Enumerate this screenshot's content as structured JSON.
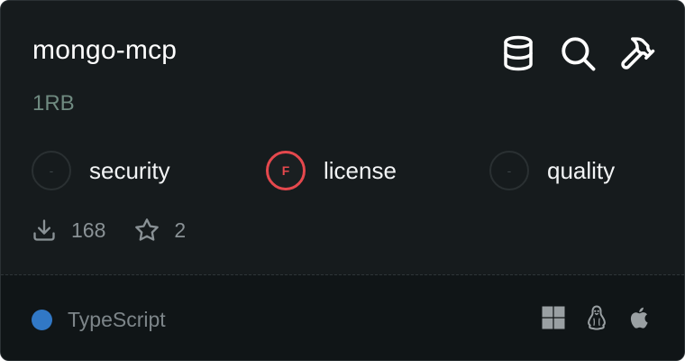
{
  "card": {
    "title": "mongo-mcp",
    "owner": "1RB",
    "header_icons": [
      "database-icon",
      "search-icon",
      "hammer-icon"
    ],
    "scores": [
      {
        "grade": "-",
        "label": "security",
        "status": "neutral"
      },
      {
        "grade": "F",
        "label": "license",
        "status": "fail"
      },
      {
        "grade": "-",
        "label": "quality",
        "status": "neutral"
      }
    ],
    "stats": {
      "downloads": "168",
      "stars": "2"
    },
    "footer": {
      "language": "TypeScript",
      "language_color": "#3178c6",
      "platforms": [
        "windows-icon",
        "linux-icon",
        "apple-icon"
      ]
    }
  },
  "colors": {
    "background": "#161b1d",
    "fail": "#e5484d",
    "owner": "#6f8a80"
  }
}
